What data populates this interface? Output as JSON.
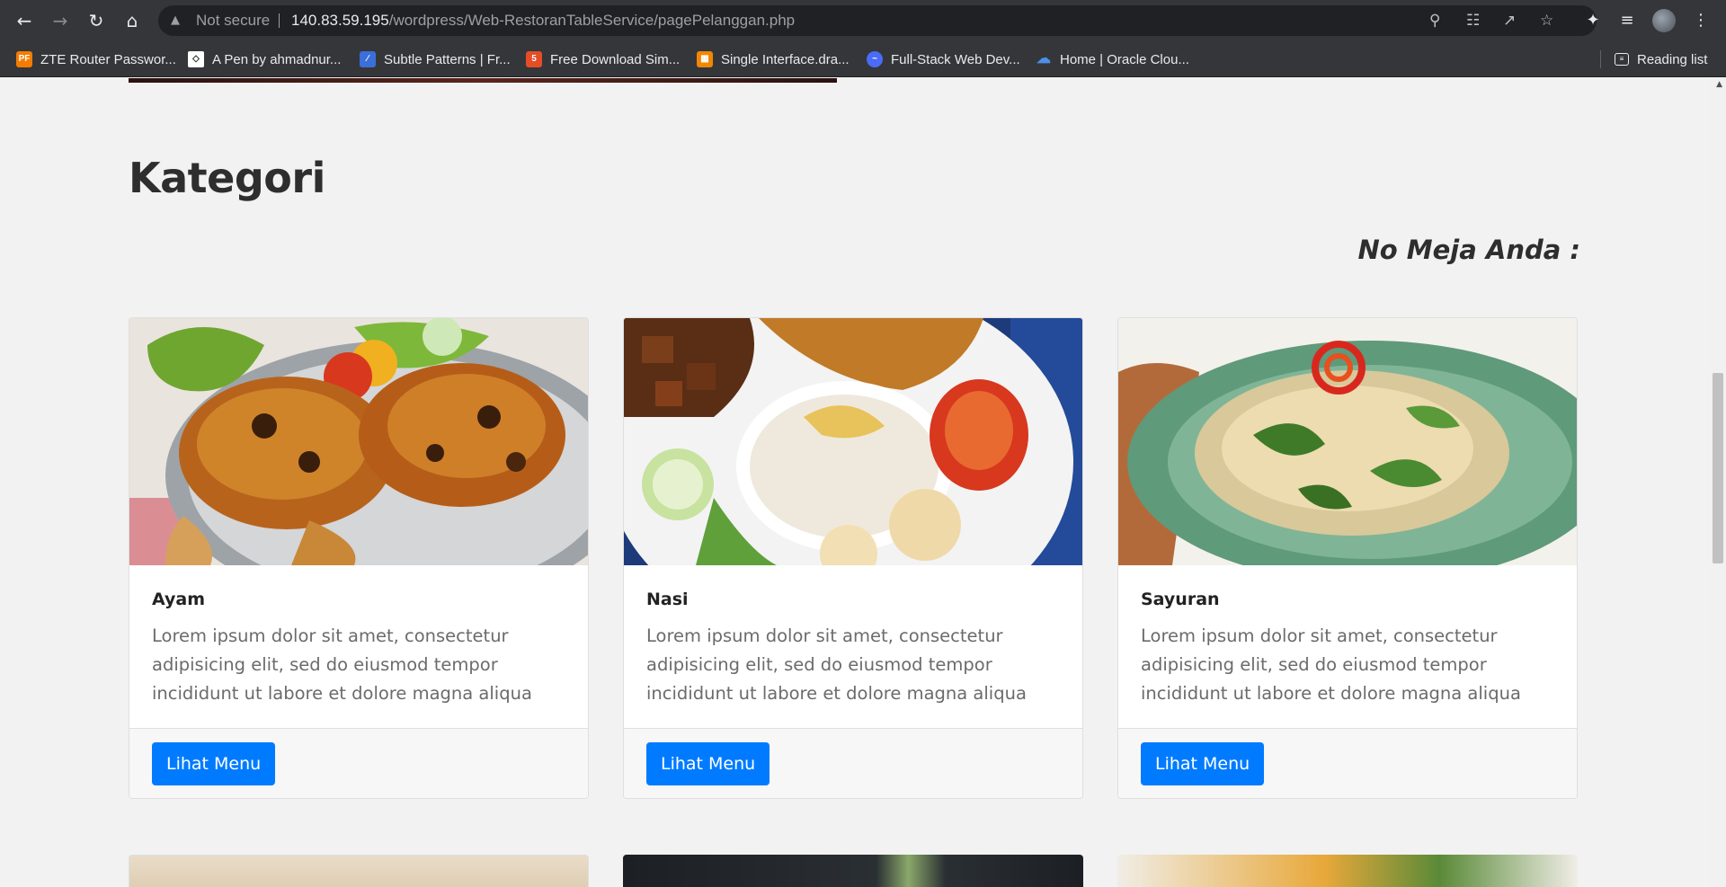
{
  "browser": {
    "security_status": "Not secure",
    "url_host": "140.83.59.195",
    "url_path": "/wordpress/Web-RestoranTableService/pagePelanggan.php",
    "bookmarks": [
      {
        "label": "ZTE Router Passwor...",
        "icon": "PF",
        "color": "#f57c00"
      },
      {
        "label": "A Pen by ahmadnur...",
        "icon": "codepen-icon",
        "color": "#ffffff"
      },
      {
        "label": "Subtle Patterns | Fr...",
        "icon": "subtle-patterns-icon",
        "color": "#3b6fd9"
      },
      {
        "label": "Free Download Sim...",
        "icon": "html5-icon",
        "color": "#e44d26"
      },
      {
        "label": "Single Interface.dra...",
        "icon": "drawio-icon",
        "color": "#f08705"
      },
      {
        "label": "Full-Stack Web Dev...",
        "icon": "fullstack-icon",
        "color": "#4a6cf7"
      },
      {
        "label": "Home | Oracle Clou...",
        "icon": "cloud-icon",
        "color": "#4e8fe8"
      }
    ],
    "reading_list": "Reading list"
  },
  "page": {
    "section_title": "Kategori",
    "table_number_label": "No Meja Anda :",
    "cards": [
      {
        "title": "Ayam",
        "text": "Lorem ipsum dolor sit amet, consectetur adipisicing elit, sed do eiusmod tempor incididunt ut labore et dolore magna aliqua",
        "button": "Lihat Menu"
      },
      {
        "title": "Nasi",
        "text": "Lorem ipsum dolor sit amet, consectetur adipisicing elit, sed do eiusmod tempor incididunt ut labore et dolore magna aliqua",
        "button": "Lihat Menu"
      },
      {
        "title": "Sayuran",
        "text": "Lorem ipsum dolor sit amet, consectetur adipisicing elit, sed do eiusmod tempor incididunt ut labore et dolore magna aliqua",
        "button": "Lihat Menu"
      }
    ]
  },
  "colors": {
    "primary_button": "#007bff",
    "browser_chrome": "#35363a",
    "page_background": "#f2f2f2"
  }
}
